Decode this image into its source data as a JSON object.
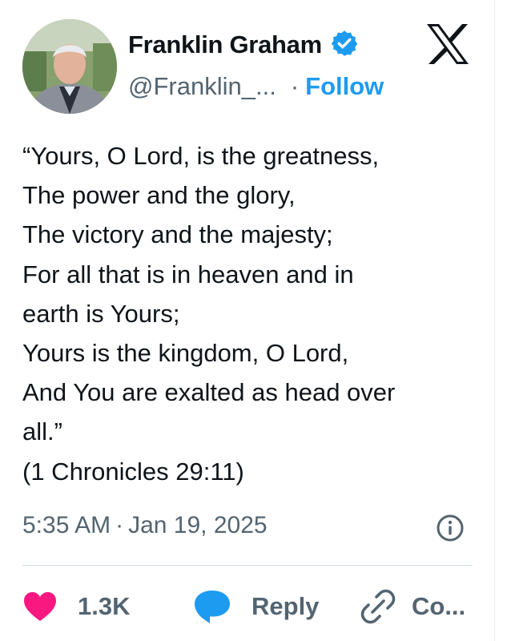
{
  "author": {
    "name": "Franklin Graham",
    "handle": "@Franklin_...",
    "separator": "·",
    "follow_label": "Follow",
    "verified_icon": "verified-badge-icon"
  },
  "platform": {
    "logo_icon": "x-logo-icon"
  },
  "tweet": {
    "lines": [
      "“Yours, O Lord, is the greatness,",
      "The power and the glory,",
      "The victory and the majesty;",
      "For all that is in heaven and in",
      "earth is Yours;",
      "Yours is the kingdom, O Lord,",
      "And You are exalted as head over",
      "all.”",
      "(1 Chronicles 29:11)"
    ],
    "time": "5:35 AM",
    "separator": "·",
    "date": "Jan 19, 2025"
  },
  "actions": {
    "likes_count": "1.3K",
    "reply_label": "Reply",
    "copy_label": "Co..."
  },
  "colors": {
    "accent": "#1d9bf0",
    "like": "#f91880",
    "text": "#0f1419",
    "secondary": "#536471"
  }
}
